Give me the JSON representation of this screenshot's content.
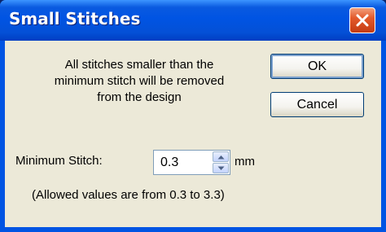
{
  "window": {
    "title": "Small Stitches"
  },
  "message": {
    "line1": "All stitches smaller than the",
    "line2": "minimum stitch will be removed",
    "line3": "from the design"
  },
  "buttons": {
    "ok": "OK",
    "cancel": "Cancel"
  },
  "minimum_stitch": {
    "label": "Minimum Stitch:",
    "value": "0.3",
    "unit": "mm"
  },
  "note": "(Allowed values are from 0.3 to 3.3)",
  "icons": {
    "close": "close-icon",
    "spin_up": "arrow-up-icon",
    "spin_down": "arrow-down-icon"
  },
  "colors": {
    "titlebar": "#0054e3",
    "client_bg": "#ece9d8",
    "close_button": "#e35a2c"
  }
}
